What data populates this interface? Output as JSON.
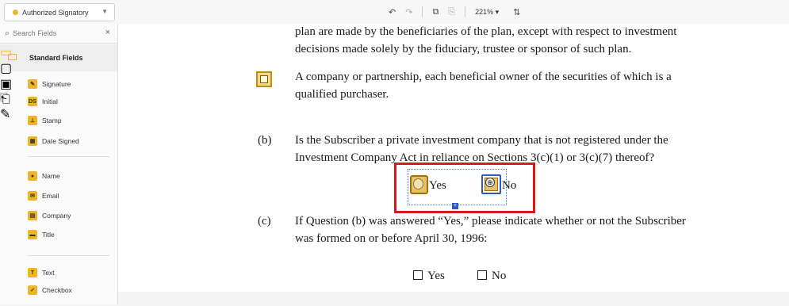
{
  "toolbar": {
    "signer": "Authorized Signatory",
    "zoom": "221% ▾",
    "undo_icon": "undo-icon",
    "redo_icon": "redo-icon",
    "copy_icon": "copy-icon",
    "paste_icon": "paste-icon",
    "sort_icon": "sort-icon"
  },
  "panel": {
    "search_placeholder": "Search Fields",
    "section": "Standard Fields",
    "fields_signing": [
      {
        "label": "Signature",
        "glyph": "✎"
      },
      {
        "label": "Initial",
        "glyph": "DS"
      },
      {
        "label": "Stamp",
        "glyph": "⊥"
      },
      {
        "label": "Date Signed",
        "glyph": "▦"
      }
    ],
    "fields_identity": [
      {
        "label": "Name",
        "glyph": "●"
      },
      {
        "label": "Email",
        "glyph": "✉"
      },
      {
        "label": "Company",
        "glyph": "▤"
      },
      {
        "label": "Title",
        "glyph": "▬"
      }
    ],
    "fields_input": [
      {
        "label": "Text",
        "glyph": "T"
      },
      {
        "label": "Checkbox",
        "glyph": "✓"
      }
    ]
  },
  "doc": {
    "para1_l1": "plan are made by the beneficiaries of the plan, except with respect to investment",
    "para1_l2": "decisions made solely by the fiduciary, trustee or sponsor of such plan.",
    "para2_l1": "A company or partnership, each beneficial owner of the securities of which is a",
    "para2_l2": "qualified purchaser.",
    "b_label": "(b)",
    "b_l1": "Is the Subscriber a private investment company that is not registered under the",
    "b_l2": "Investment Company Act in reliance on Sections 3(c)(1) or 3(c)(7) thereof?",
    "yes": "Yes",
    "no": "No",
    "c_label": "(c)",
    "c_l1": "If Question (b) was answered “Yes,” please indicate whether or not the Subscriber",
    "c_l2": "was formed on or before April 30, 1996:",
    "c_yes": "Yes",
    "c_no": "No"
  }
}
